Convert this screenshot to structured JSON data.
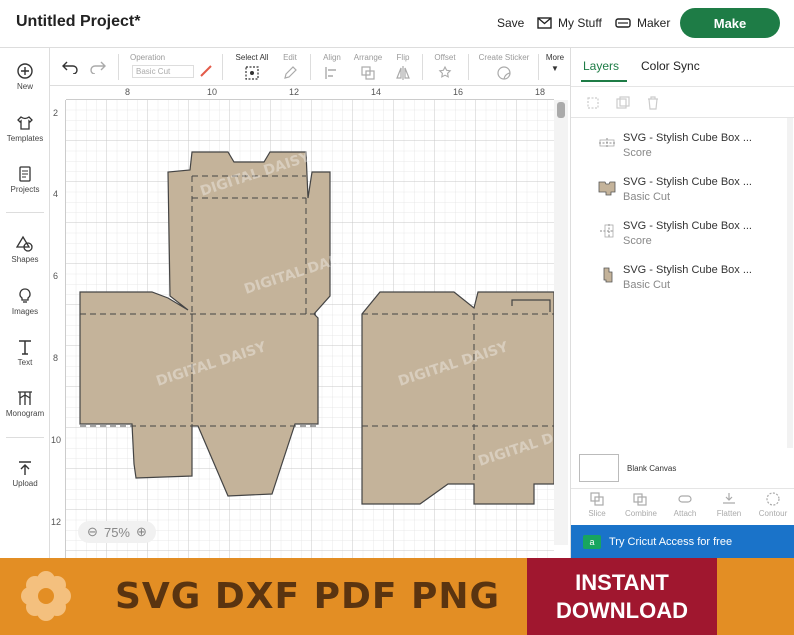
{
  "header": {
    "project_title": "Untitled Project*",
    "save_label": "Save",
    "my_stuff_label": "My Stuff",
    "maker_label": "Maker",
    "make_label": "Make",
    "brand_color": "#1e7c46"
  },
  "sidebar": {
    "items": [
      {
        "label": "New",
        "icon": "plus-circle-icon"
      },
      {
        "label": "Templates",
        "icon": "shirt-icon"
      },
      {
        "label": "Projects",
        "icon": "projects-icon"
      },
      {
        "label": "Shapes",
        "icon": "shapes-icon"
      },
      {
        "label": "Images",
        "icon": "lightbulb-icon"
      },
      {
        "label": "Text",
        "icon": "text-icon"
      },
      {
        "label": "Monogram",
        "icon": "monogram-icon"
      },
      {
        "label": "Upload",
        "icon": "upload-icon"
      }
    ]
  },
  "toolbar": {
    "operation_label": "Operation",
    "operation_value": "Basic Cut",
    "select_all_label": "Select All",
    "edit_label": "Edit",
    "align_label": "Align",
    "arrange_label": "Arrange",
    "flip_label": "Flip",
    "offset_label": "Offset",
    "create_sticker_label": "Create Sticker",
    "more_label": "More"
  },
  "canvas": {
    "ruler_top": [
      "8",
      "10",
      "12",
      "14",
      "16",
      "18"
    ],
    "ruler_left": [
      "2",
      "4",
      "6",
      "8",
      "10",
      "12"
    ],
    "zoom_minus": "⊖",
    "zoom_value": "75%",
    "zoom_plus": "⊕",
    "watermark": "DIGITAL DAISY",
    "shape_fill": "#c4b39a"
  },
  "right_panel": {
    "tabs": [
      "Layers",
      "Color Sync"
    ],
    "layers": [
      {
        "name": "SVG - Stylish Cube Box ...",
        "type": "Score"
      },
      {
        "name": "SVG - Stylish Cube Box ...",
        "type": "Basic Cut"
      },
      {
        "name": "SVG - Stylish Cube Box ...",
        "type": "Score"
      },
      {
        "name": "SVG - Stylish Cube Box ...",
        "type": "Basic Cut"
      }
    ],
    "blank_canvas_label": "Blank Canvas",
    "bottom_tools": [
      "Slice",
      "Combine",
      "Attach",
      "Flatten",
      "Contour"
    ],
    "access_label": "Try Cricut Access for free",
    "access_color": "#1a73c9"
  },
  "banner": {
    "formats": "SVG DXF PDF PNG",
    "cta_line1": "INSTANT",
    "cta_line2": "DOWNLOAD",
    "background": "#e38e24",
    "cta_color": "#a0172f"
  }
}
